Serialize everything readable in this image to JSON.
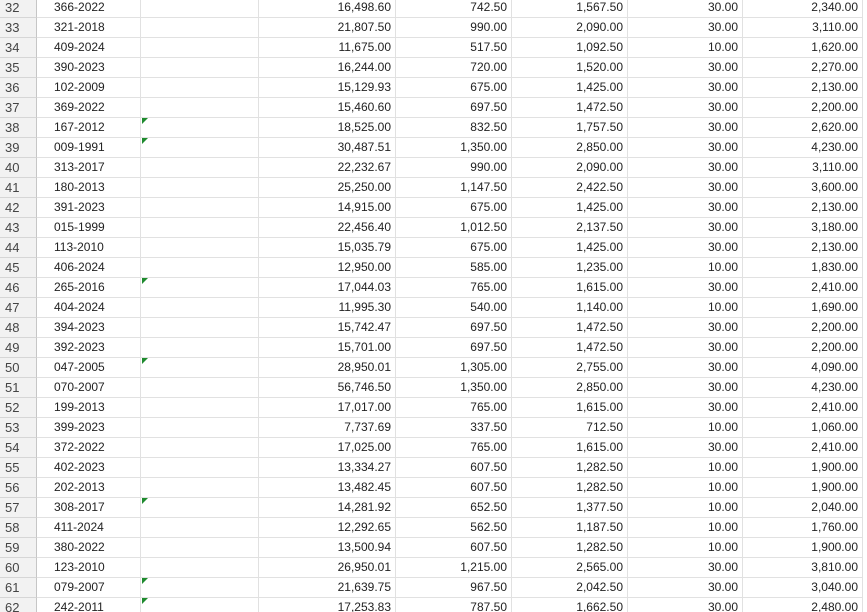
{
  "rows": [
    {
      "n": "32",
      "id": "366-2022",
      "v": [
        "16,498.60",
        "742.50",
        "1,567.50",
        "30.00",
        "2,340.00"
      ]
    },
    {
      "n": "33",
      "id": "321-2018",
      "v": [
        "21,807.50",
        "990.00",
        "2,090.00",
        "30.00",
        "3,110.00"
      ]
    },
    {
      "n": "34",
      "id": "409-2024",
      "v": [
        "11,675.00",
        "517.50",
        "1,092.50",
        "10.00",
        "1,620.00"
      ]
    },
    {
      "n": "35",
      "id": "390-2023",
      "v": [
        "16,244.00",
        "720.00",
        "1,520.00",
        "30.00",
        "2,270.00"
      ]
    },
    {
      "n": "36",
      "id": "102-2009",
      "v": [
        "15,129.93",
        "675.00",
        "1,425.00",
        "30.00",
        "2,130.00"
      ]
    },
    {
      "n": "37",
      "id": "369-2022",
      "v": [
        "15,460.60",
        "697.50",
        "1,472.50",
        "30.00",
        "2,200.00"
      ]
    },
    {
      "n": "38",
      "id": "167-2012",
      "v": [
        "18,525.00",
        "832.50",
        "1,757.50",
        "30.00",
        "2,620.00"
      ],
      "flag": true
    },
    {
      "n": "39",
      "id": "009-1991",
      "v": [
        "30,487.51",
        "1,350.00",
        "2,850.00",
        "30.00",
        "4,230.00"
      ],
      "flag": true
    },
    {
      "n": "40",
      "id": "313-2017",
      "v": [
        "22,232.67",
        "990.00",
        "2,090.00",
        "30.00",
        "3,110.00"
      ]
    },
    {
      "n": "41",
      "id": "180-2013",
      "v": [
        "25,250.00",
        "1,147.50",
        "2,422.50",
        "30.00",
        "3,600.00"
      ]
    },
    {
      "n": "42",
      "id": "391-2023",
      "v": [
        "14,915.00",
        "675.00",
        "1,425.00",
        "30.00",
        "2,130.00"
      ]
    },
    {
      "n": "43",
      "id": "015-1999",
      "v": [
        "22,456.40",
        "1,012.50",
        "2,137.50",
        "30.00",
        "3,180.00"
      ]
    },
    {
      "n": "44",
      "id": "113-2010",
      "v": [
        "15,035.79",
        "675.00",
        "1,425.00",
        "30.00",
        "2,130.00"
      ]
    },
    {
      "n": "45",
      "id": "406-2024",
      "v": [
        "12,950.00",
        "585.00",
        "1,235.00",
        "10.00",
        "1,830.00"
      ]
    },
    {
      "n": "46",
      "id": "265-2016",
      "v": [
        "17,044.03",
        "765.00",
        "1,615.00",
        "30.00",
        "2,410.00"
      ],
      "flag": true
    },
    {
      "n": "47",
      "id": "404-2024",
      "v": [
        "11,995.30",
        "540.00",
        "1,140.00",
        "10.00",
        "1,690.00"
      ]
    },
    {
      "n": "48",
      "id": "394-2023",
      "v": [
        "15,742.47",
        "697.50",
        "1,472.50",
        "30.00",
        "2,200.00"
      ]
    },
    {
      "n": "49",
      "id": "392-2023",
      "v": [
        "15,701.00",
        "697.50",
        "1,472.50",
        "30.00",
        "2,200.00"
      ]
    },
    {
      "n": "50",
      "id": "047-2005",
      "v": [
        "28,950.01",
        "1,305.00",
        "2,755.00",
        "30.00",
        "4,090.00"
      ],
      "flag": true
    },
    {
      "n": "51",
      "id": "070-2007",
      "v": [
        "56,746.50",
        "1,350.00",
        "2,850.00",
        "30.00",
        "4,230.00"
      ]
    },
    {
      "n": "52",
      "id": "199-2013",
      "v": [
        "17,017.00",
        "765.00",
        "1,615.00",
        "30.00",
        "2,410.00"
      ]
    },
    {
      "n": "53",
      "id": "399-2023",
      "v": [
        "7,737.69",
        "337.50",
        "712.50",
        "10.00",
        "1,060.00"
      ]
    },
    {
      "n": "54",
      "id": "372-2022",
      "v": [
        "17,025.00",
        "765.00",
        "1,615.00",
        "30.00",
        "2,410.00"
      ]
    },
    {
      "n": "55",
      "id": "402-2023",
      "v": [
        "13,334.27",
        "607.50",
        "1,282.50",
        "10.00",
        "1,900.00"
      ]
    },
    {
      "n": "56",
      "id": "202-2013",
      "v": [
        "13,482.45",
        "607.50",
        "1,282.50",
        "10.00",
        "1,900.00"
      ]
    },
    {
      "n": "57",
      "id": "308-2017",
      "v": [
        "14,281.92",
        "652.50",
        "1,377.50",
        "10.00",
        "2,040.00"
      ],
      "flag": true
    },
    {
      "n": "58",
      "id": "411-2024",
      "v": [
        "12,292.65",
        "562.50",
        "1,187.50",
        "10.00",
        "1,760.00"
      ]
    },
    {
      "n": "59",
      "id": "380-2022",
      "v": [
        "13,500.94",
        "607.50",
        "1,282.50",
        "10.00",
        "1,900.00"
      ]
    },
    {
      "n": "60",
      "id": "123-2010",
      "v": [
        "26,950.01",
        "1,215.00",
        "2,565.00",
        "30.00",
        "3,810.00"
      ]
    },
    {
      "n": "61",
      "id": "079-2007",
      "v": [
        "21,639.75",
        "967.50",
        "2,042.50",
        "30.00",
        "3,040.00"
      ],
      "flag": true
    },
    {
      "n": "62",
      "id": "242-2011",
      "v": [
        "17,253.83",
        "787.50",
        "1,662.50",
        "30.00",
        "2,480.00"
      ],
      "flag": true
    }
  ]
}
